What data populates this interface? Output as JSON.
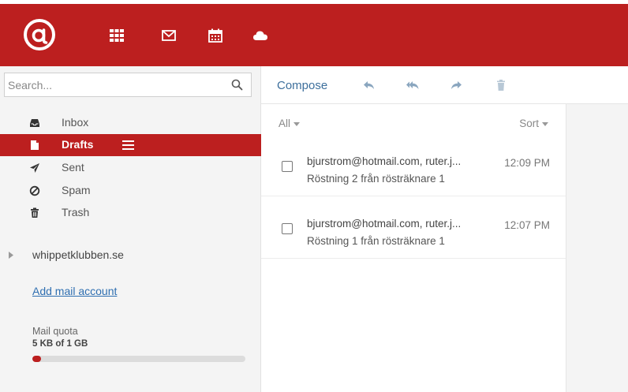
{
  "topnav": {
    "brand_color": "#bc1f1f",
    "logo_icon": "webmail-logo-icon",
    "items": [
      {
        "icon": "apps-grid-icon"
      },
      {
        "icon": "mail-icon"
      },
      {
        "icon": "calendar-icon"
      },
      {
        "icon": "cloud-icon"
      }
    ]
  },
  "search": {
    "placeholder": "Search...",
    "value": ""
  },
  "folders": [
    {
      "label": "Inbox",
      "icon": "inbox-icon"
    },
    {
      "label": "Drafts",
      "icon": "file-icon",
      "active": true
    },
    {
      "label": "Sent",
      "icon": "paper-plane-icon"
    },
    {
      "label": "Spam",
      "icon": "ban-icon"
    },
    {
      "label": "Trash",
      "icon": "trash-icon"
    }
  ],
  "account": {
    "label": "whippetklubben.se"
  },
  "add_account_label": "Add mail account",
  "quota": {
    "label": "Mail quota",
    "value": "5 KB of 1 GB",
    "fraction": 0.04
  },
  "toolbar": {
    "compose_label": "Compose",
    "icons": [
      "reply-icon",
      "reply-all-icon",
      "forward-icon",
      "delete-icon"
    ]
  },
  "list": {
    "filter_label": "All",
    "sort_label": "Sort",
    "messages": [
      {
        "from": "bjurstrom@hotmail.com, ruter.j...",
        "time": "12:09 PM",
        "subject": "Röstning 2 från rösträknare 1"
      },
      {
        "from": "bjurstrom@hotmail.com, ruter.j...",
        "time": "12:07 PM",
        "subject": "Röstning 1 från rösträknare 1"
      }
    ]
  }
}
